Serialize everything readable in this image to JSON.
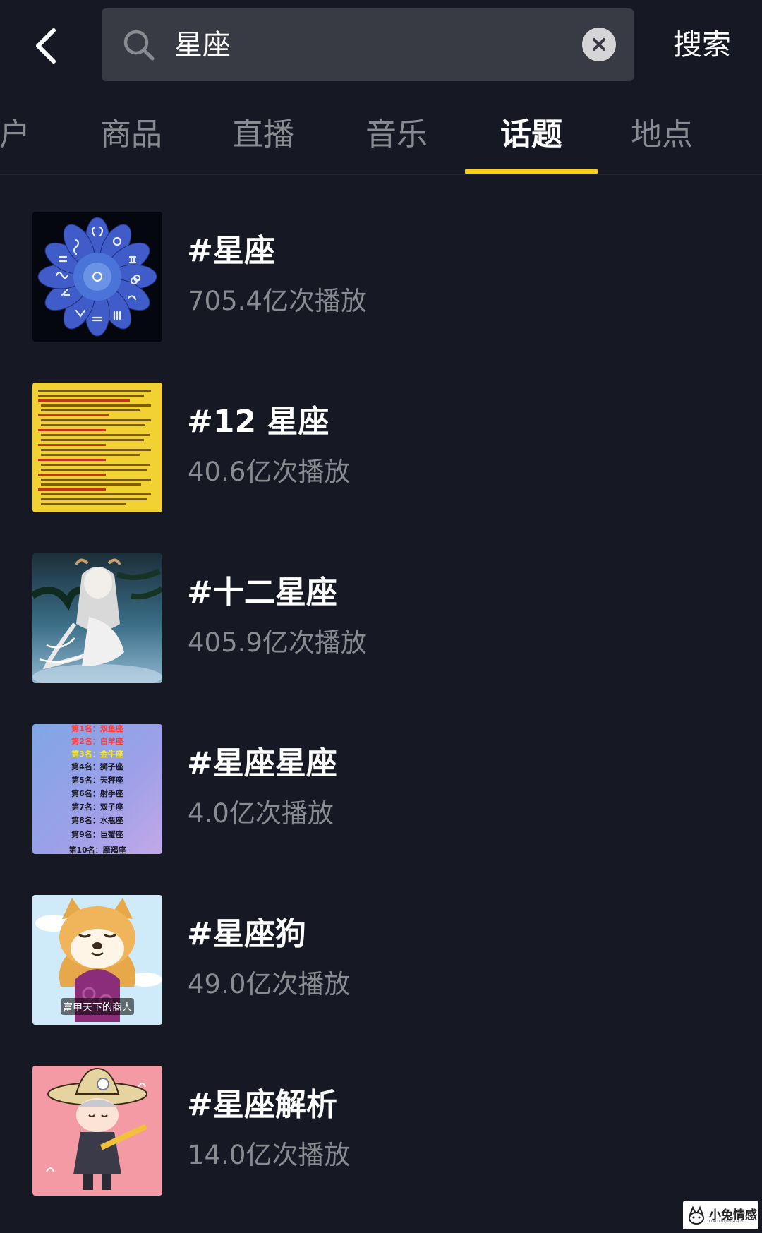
{
  "search": {
    "query": "星座",
    "submit_label": "搜索"
  },
  "tabs": [
    {
      "label": "户",
      "active": false
    },
    {
      "label": "商品",
      "active": false
    },
    {
      "label": "直播",
      "active": false
    },
    {
      "label": "音乐",
      "active": false
    },
    {
      "label": "话题",
      "active": true
    },
    {
      "label": "地点",
      "active": false
    }
  ],
  "topics": [
    {
      "title": "#星座",
      "plays": "705.4亿次播放"
    },
    {
      "title": "#12 星座",
      "plays": "40.6亿次播放"
    },
    {
      "title": "#十二星座",
      "plays": "405.9亿次播放"
    },
    {
      "title": "#星座星座",
      "plays": "4.0亿次播放"
    },
    {
      "title": "#星座狗",
      "plays": "49.0亿次播放"
    },
    {
      "title": "#星座解析",
      "plays": "14.0亿次播放"
    }
  ],
  "thumbnail_text": {
    "ranking": [
      "第1名：双鱼座",
      "第2名：白羊座",
      "第3名：金牛座",
      "第4名：狮子座",
      "第5名：天秤座",
      "第6名：射手座",
      "第7名：双子座",
      "第8名：水瓶座",
      "第9名：巨蟹座",
      "第10名：摩羯座"
    ],
    "dog_caption": "富甲天下的商人"
  },
  "watermark": {
    "text": "小兔情感",
    "subtext": "XIAOTUQINGGAN"
  },
  "colors": {
    "background": "#161823",
    "search_box": "#393b44",
    "tab_indicator": "#face15",
    "secondary_text": "#8a8b91"
  }
}
